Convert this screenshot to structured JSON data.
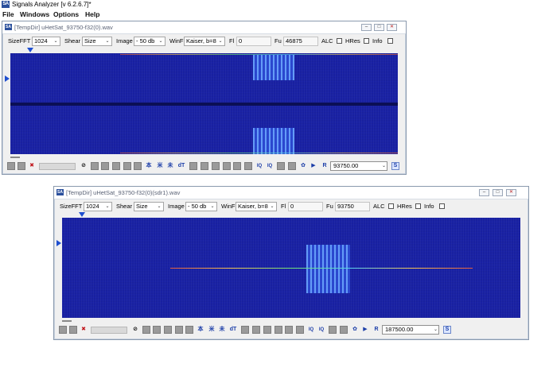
{
  "app": {
    "logo_text": "SA",
    "title": "Signals Analyzer [v 6.2.6.7]*",
    "menu": [
      "File",
      "Windows",
      "Options",
      "Help"
    ]
  },
  "windows": [
    {
      "title": "[TempDir] uHetSat_93750-f32(0).wav",
      "controls": {
        "minimize": "–",
        "maximize": "□",
        "close": "✕"
      },
      "toolbar": {
        "sizefft_label": "SizeFFT",
        "sizefft_value": "1024",
        "shear_label": "Shear",
        "shear_value": "Size",
        "image_label": "Image",
        "image_value": "- 50 db",
        "winf_label": "WinF",
        "winf_value": "Kaiser, b=8",
        "fl_label": "Fl",
        "fl_value": "0",
        "fu_label": "Fu",
        "fu_value": "46875",
        "alc_label": "ALC",
        "hres_label": "HRes",
        "info_label": "Info"
      },
      "bottom": {
        "frequency": "93750.00",
        "s_label": "S"
      }
    },
    {
      "title": "[TempDir] uHetSat_93750-f32(0)(sdr1).wav",
      "controls": {
        "minimize": "–",
        "maximize": "□",
        "close": "✕"
      },
      "toolbar": {
        "sizefft_label": "SizeFFT",
        "sizefft_value": "1024",
        "shear_label": "Shear",
        "shear_value": "Size",
        "image_label": "Image",
        "image_value": "- 50 db",
        "winf_label": "WinF",
        "winf_value": "Kaiser, b=8",
        "fl_label": "Fl",
        "fl_value": "0",
        "fu_label": "Fu",
        "fu_value": "93750",
        "alc_label": "ALC",
        "hres_label": "HRes",
        "info_label": "Info"
      },
      "bottom": {
        "frequency": "187500.00",
        "s_label": "S"
      }
    }
  ],
  "toolbar_icons": {
    "tool_a": "⊘",
    "tool_b": "本",
    "tool_c": "米",
    "tool_d": "未",
    "dt_label": "dT",
    "iq_a": "IQ",
    "iq_b": "IQ",
    "gear": "✿",
    "play": "▶",
    "r_label": "R",
    "cross": "✖"
  },
  "colors": {
    "spectrogram_bg": "#1a22a8",
    "marker": "#1f4fcf",
    "accent": "#2a4f9c"
  }
}
